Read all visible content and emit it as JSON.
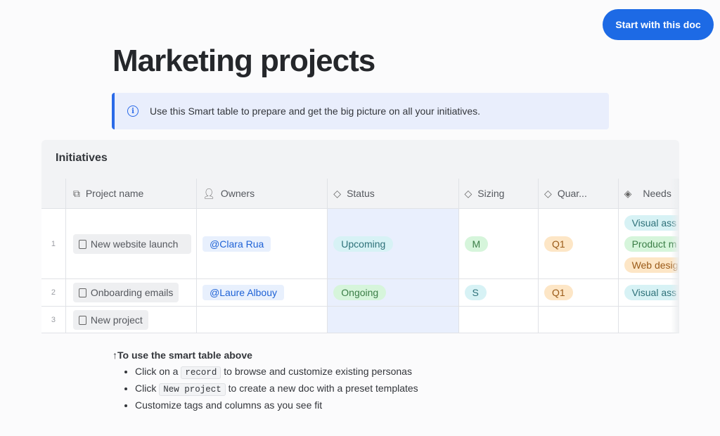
{
  "header": {
    "start_button": "Start with this doc",
    "title": "Marketing projects"
  },
  "callout": {
    "text": "Use this Smart table to prepare and get the big picture on all your initiatives."
  },
  "table": {
    "title": "Initiatives",
    "columns": [
      "Project name",
      "Owners",
      "Status",
      "Sizing",
      "Quar...",
      "Needs"
    ],
    "rows": [
      {
        "num": "1",
        "name": "New website launch",
        "owner": "@Clara Rua",
        "status": "Upcoming",
        "sizing": "M",
        "quarter": "Q1",
        "needs": [
          "Visual ass",
          "Product m",
          "Web desig"
        ]
      },
      {
        "num": "2",
        "name": "Onboarding emails",
        "owner": "@Laure Albouy",
        "status": "Ongoing",
        "sizing": "S",
        "quarter": "Q1",
        "needs": [
          "Visual ass"
        ]
      },
      {
        "num": "3",
        "name": "New project"
      }
    ]
  },
  "notes": {
    "heading": "↑To use the smart table above",
    "items": [
      {
        "before": "Click on a",
        "code": "record",
        "after": "to browse and customize existing personas"
      },
      {
        "before": "Click",
        "code": "New project",
        "after": "to create a new doc with a preset templates"
      },
      {
        "text": "Customize tags and columns as you see fit"
      }
    ]
  },
  "colors": {
    "accent": "#1d6ae5"
  }
}
